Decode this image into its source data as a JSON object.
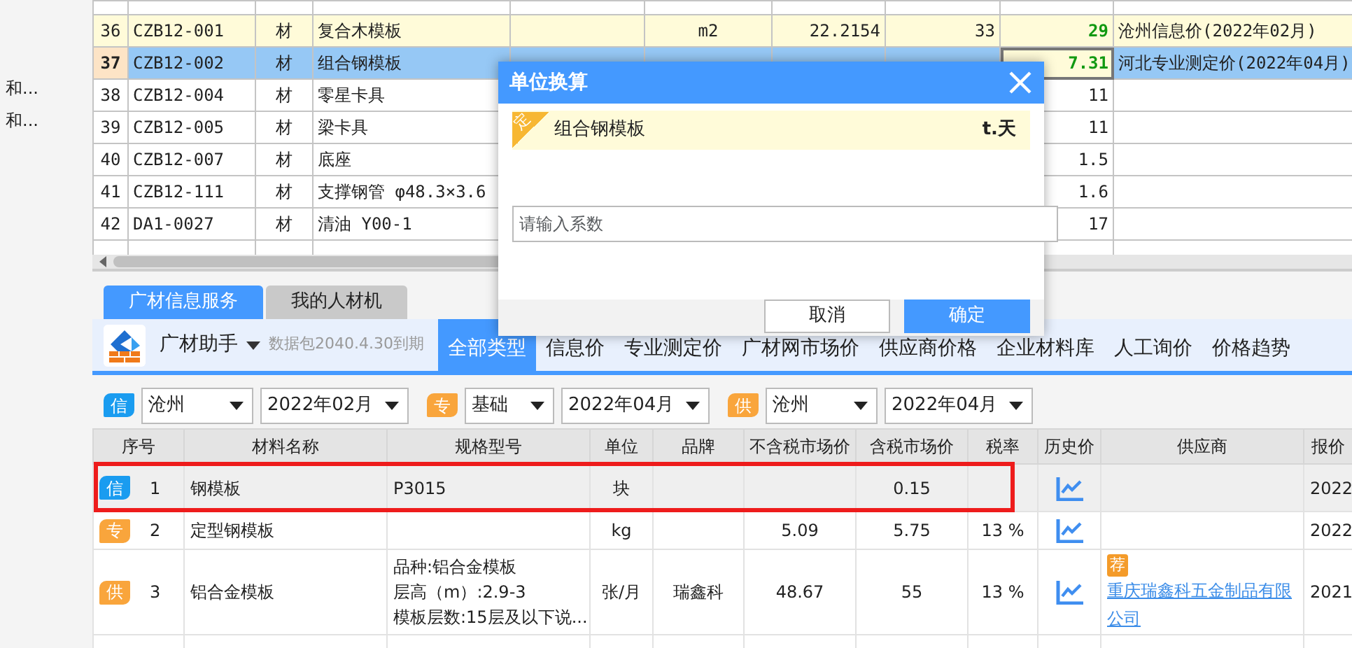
{
  "sidebar": {
    "items": [
      "和...",
      "和..."
    ]
  },
  "materials_grid": {
    "rows": [
      {
        "num": "36",
        "code": "CZB12-001",
        "type": "材",
        "name": "复合木模板",
        "unit": "m2",
        "price": "22.2154",
        "qty": "33",
        "value": "29",
        "source": "沧州信息价(2022年02月)",
        "highlighted": true,
        "selected": false
      },
      {
        "num": "37",
        "code": "CZB12-002",
        "type": "材",
        "name": "组合钢模板",
        "value": "7.31",
        "source": "河北专业测定价(2022年04月)",
        "highlighted": false,
        "selected": true
      },
      {
        "num": "38",
        "code": "CZB12-004",
        "type": "材",
        "name": "零星卡具",
        "value": "11",
        "highlighted": false,
        "selected": false
      },
      {
        "num": "39",
        "code": "CZB12-005",
        "type": "材",
        "name": "梁卡具",
        "value": "11",
        "highlighted": false,
        "selected": false
      },
      {
        "num": "40",
        "code": "CZB12-007",
        "type": "材",
        "name": "底座",
        "value": "1.5",
        "highlighted": false,
        "selected": false
      },
      {
        "num": "41",
        "code": "CZB12-111",
        "type": "材",
        "name": "支撑钢管 φ48.3×3.6",
        "value": "1.6",
        "highlighted": false,
        "selected": false
      },
      {
        "num": "42",
        "code": "DA1-0027",
        "type": "材",
        "name": "清油 Y00-1",
        "value": "17",
        "highlighted": false,
        "selected": false
      }
    ]
  },
  "dialog": {
    "title": "单位换算",
    "tag": "定",
    "material": "组合钢模板",
    "unit": "t.天",
    "coefficient_placeholder": "请输入系数",
    "buttons": [
      {
        "label": "取消",
        "kind": "secondary"
      },
      {
        "label": "确定",
        "kind": "primary"
      }
    ]
  },
  "bottom_tabs": [
    {
      "label": "广材信息服务",
      "selected": true
    },
    {
      "label": "我的人材机",
      "selected": false
    }
  ],
  "assistant": {
    "name": "广材助手",
    "expiry": "数据包2040.4.30到期"
  },
  "price_types": [
    {
      "label": "全部类型",
      "selected": true
    },
    {
      "label": "信息价",
      "selected": false
    },
    {
      "label": "专业测定价",
      "selected": false
    },
    {
      "label": "广材网市场价",
      "selected": false
    },
    {
      "label": "供应商价格",
      "selected": false
    },
    {
      "label": "企业材料库",
      "selected": false
    },
    {
      "label": "人工询价",
      "selected": false
    },
    {
      "label": "价格趋势",
      "selected": false
    }
  ],
  "filters": [
    {
      "tag": "信",
      "color": "#1a9cf0",
      "first": "沧州",
      "period": "2022年02月"
    },
    {
      "tag": "专",
      "color": "#f9a53c",
      "first": "基础",
      "period": "2022年04月"
    },
    {
      "tag": "供",
      "color": "#f9a53c",
      "first": "沧州",
      "period": "2022年04月"
    }
  ],
  "results": {
    "columns": [
      "序号",
      "材料名称",
      "规格型号",
      "单位",
      "品牌",
      "不含税市场价",
      "含税市场价",
      "税率",
      "历史价",
      "供应商",
      "报价"
    ],
    "rows": [
      {
        "tag": "信",
        "color": "#1a9cf0",
        "num": "1",
        "name": "钢模板",
        "spec": [
          "P3015"
        ],
        "unit": "块",
        "price_ex_tax": "",
        "price_inc_tax": "0.15",
        "tax": "",
        "supplier": "",
        "date": "2022",
        "selected": true,
        "annotated": true
      },
      {
        "tag": "专",
        "color": "#f9a53c",
        "num": "2",
        "name": "定型钢模板",
        "spec": [],
        "unit": "kg",
        "brand": "",
        "price_ex_tax": "5.09",
        "price_inc_tax": "5.75",
        "tax": "13 %",
        "supplier": "",
        "date": "2022",
        "selected": false,
        "annotated": false
      },
      {
        "tag": "供",
        "color": "#f9a53c",
        "num": "3",
        "name": "铝合金模板",
        "spec": [
          "品种:铝合金模板",
          "层高（m）:2.9-3",
          "模板层数:15层及以下说..."
        ],
        "unit": "张/月",
        "brand": "瑞鑫科",
        "price_ex_tax": "48.67",
        "price_inc_tax": "55",
        "tax": "13 %",
        "supplier": "重庆瑞鑫科五金制品有限公司",
        "recommend_label": "荐",
        "date": "2021",
        "selected": false,
        "annotated": false
      }
    ]
  }
}
